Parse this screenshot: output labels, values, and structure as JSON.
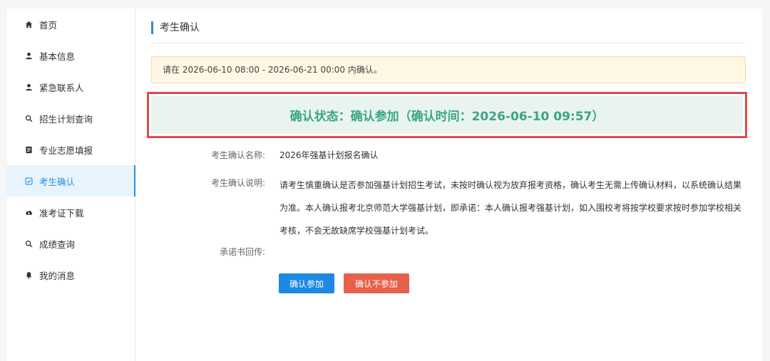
{
  "sidebar": {
    "items": [
      {
        "label": "首页",
        "icon": "home-icon"
      },
      {
        "label": "基本信息",
        "icon": "user-icon"
      },
      {
        "label": "紧急联系人",
        "icon": "user-icon"
      },
      {
        "label": "招生计划查询",
        "icon": "search-icon"
      },
      {
        "label": "专业志愿填报",
        "icon": "form-icon"
      },
      {
        "label": "考生确认",
        "icon": "checkbox-icon",
        "active": true
      },
      {
        "label": "准考证下载",
        "icon": "cloud-download-icon"
      },
      {
        "label": "成绩查询",
        "icon": "search-icon"
      },
      {
        "label": "我的消息",
        "icon": "bell-icon"
      }
    ]
  },
  "page": {
    "title": "考生确认",
    "notice": "请在 2026-06-10 08:00 - 2026-06-21 00:00 内确认。",
    "status": "确认状态：确认参加（确认时间：2026-06-10 09:57）"
  },
  "form": {
    "name_label": "考生确认名称:",
    "name_value": "2026年强基计划报名确认",
    "desc_label": "考生确认说明:",
    "desc_value": "请考生慎重确认是否参加强基计划招生考试，未按时确认视为放弃报考资格，确认考生无需上传确认材料，以系统确认结果为准。本人确认报考北京师范大学强基计划，即承诺：本人确认报考强基计划，如入围校考将按学校要求按时参加学校相关考核，不会无故缺席学校强基计划考试。",
    "upload_label": "承诺书回传:"
  },
  "buttons": {
    "join": "确认参加",
    "decline": "确认不参加"
  },
  "colors": {
    "accent": "#2b8fe0",
    "status_text": "#3aa77e",
    "status_bg": "#e9f4f1",
    "highlight_border": "#e04b4b",
    "notice_bg": "#fdf7e3",
    "join_button": "#1e88e5",
    "decline_button": "#e8604a"
  }
}
